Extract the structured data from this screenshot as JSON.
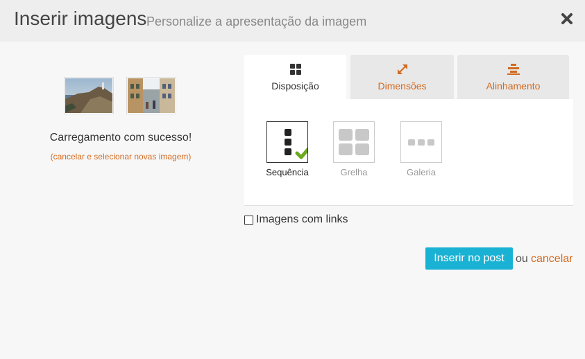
{
  "dialog": {
    "title": "Inserir imagens",
    "subtitle": "Personalize a apresentação da imagem"
  },
  "upload": {
    "status": "Carregamento com sucesso!",
    "cancel_select": "(cancelar e selecionar novas imagem)",
    "thumbnails": [
      "coastal-cliff-photo",
      "narrow-street-photo"
    ]
  },
  "tabs": [
    {
      "label": "Disposição",
      "icon": "grid-icon",
      "active": true
    },
    {
      "label": "Dimensões",
      "icon": "resize-arrows-icon",
      "active": false
    },
    {
      "label": "Alinhamento",
      "icon": "align-center-icon",
      "active": false
    }
  ],
  "layout_options": [
    {
      "label": "Sequência",
      "icon": "sequence-icon",
      "selected": true
    },
    {
      "label": "Grelha",
      "icon": "grid-layout-icon",
      "selected": false
    },
    {
      "label": "Galeria",
      "icon": "gallery-icon",
      "selected": false
    }
  ],
  "images_with_links": {
    "label": "Imagens com links",
    "checked": false
  },
  "actions": {
    "insert_label": "Inserir no post",
    "or_label": "ou",
    "cancel_label": "cancelar"
  },
  "colors": {
    "accent": "#d2691e",
    "primary_button": "#1ab2d4",
    "check_mark": "#6aaa1e"
  }
}
